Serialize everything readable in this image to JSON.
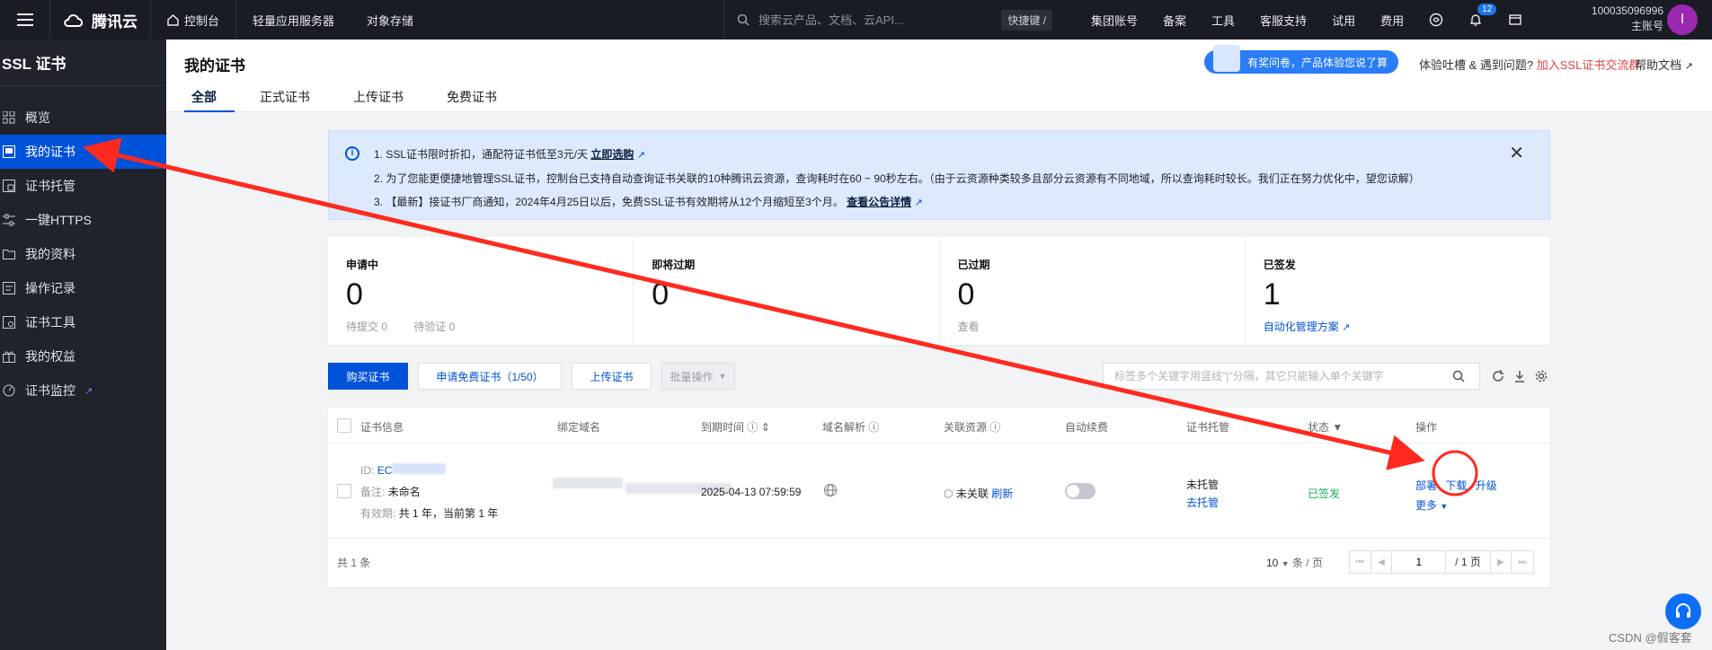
{
  "topbar": {
    "brand": "腾讯云",
    "console": "控制台",
    "items": [
      "轻量应用服务器",
      "对象存储"
    ],
    "search_placeholder": "搜索云产品、文档、云API...",
    "shortcut": "快捷键 /",
    "right_items": [
      "集团账号",
      "备案",
      "工具",
      "客服支持",
      "试用",
      "费用"
    ],
    "notification_count": "12",
    "account_id": "100035096996",
    "account_role": "主账号",
    "avatar_letter": "I"
  },
  "sidebar": {
    "title": "SSL 证书",
    "items": [
      {
        "label": "概览",
        "icon": "grid-icon"
      },
      {
        "label": "我的证书",
        "icon": "certificate-icon"
      },
      {
        "label": "证书托管",
        "icon": "hosting-icon"
      },
      {
        "label": "一键HTTPS",
        "icon": "sliders-icon"
      },
      {
        "label": "我的资料",
        "icon": "folder-icon"
      },
      {
        "label": "操作记录",
        "icon": "record-icon"
      },
      {
        "label": "证书工具",
        "icon": "tool-icon"
      },
      {
        "label": "我的权益",
        "icon": "gift-icon"
      },
      {
        "label": "证书监控",
        "icon": "monitor-icon"
      }
    ],
    "active_index": 1
  },
  "header": {
    "title": "我的证书",
    "tabs": [
      "全部",
      "正式证书",
      "上传证书",
      "免费证书"
    ],
    "survey": "有奖问卷，产品体验您说了算",
    "help_prefix": "体验吐槽 & 遇到问题?",
    "help_link": "加入SSL证书交流群",
    "docs": "帮助文档"
  },
  "notice": {
    "line1": "1. SSL证书限时折扣，通配符证书低至3元/天",
    "line1_link": "立即选购",
    "line2": "2. 为了您能更便捷地管理SSL证书，控制台已支持自动查询证书关联的10种腾讯云资源，查询耗时在60 ~ 90秒左右。（由于云资源种类较多且部分云资源有不同地域，所以查询耗时较长。我们正在努力优化中，望您谅解）",
    "line3": "3. 【最新】接证书厂商通知，2024年4月25日以后，免费SSL证书有效期将从12个月缩短至3个月。",
    "line3_link": "查看公告详情"
  },
  "stats": [
    {
      "title": "申请中",
      "value": "0",
      "sub1": "待提交 0",
      "sub2": "待验证 0"
    },
    {
      "title": "即将过期",
      "value": "0"
    },
    {
      "title": "已过期",
      "value": "0",
      "sub1": "查看"
    },
    {
      "title": "已签发",
      "value": "1",
      "link": "自动化管理方案"
    }
  ],
  "toolbar": {
    "buy": "购买证书",
    "apply_free": "申请免费证书（1/50）",
    "upload": "上传证书",
    "batch": "批量操作",
    "search_placeholder": "标签多个关键字用竖线\"|\"分隔，其它只能输入单个关键字"
  },
  "table": {
    "columns": [
      "证书信息",
      "绑定域名",
      "到期时间",
      "域名解析",
      "关联资源",
      "自动续费",
      "证书托管",
      "状态",
      "操作"
    ],
    "row": {
      "id_label": "ID:",
      "id_value": "EC",
      "note_label": "备注:",
      "note_value": "未命名",
      "validity_label": "有效期:",
      "validity_value": "共 1 年，当前第 1 年",
      "expire": "2025-04-13 07:59:59",
      "resource": "未关联",
      "refresh": "刷新",
      "hosting": "未托管",
      "hosting_link": "去托管",
      "status": "已签发",
      "actions": [
        "部署",
        "下载",
        "升级"
      ],
      "more": "更多"
    },
    "total": "共 1 条",
    "page_size": "10",
    "per_page": "条 / 页",
    "page_current": "1",
    "page_total": "/ 1 页"
  },
  "watermark": "CSDN @假客套",
  "colors": {
    "accent": "#0052d9",
    "annotation": "#ff2a1f",
    "success": "#1aae5b"
  }
}
